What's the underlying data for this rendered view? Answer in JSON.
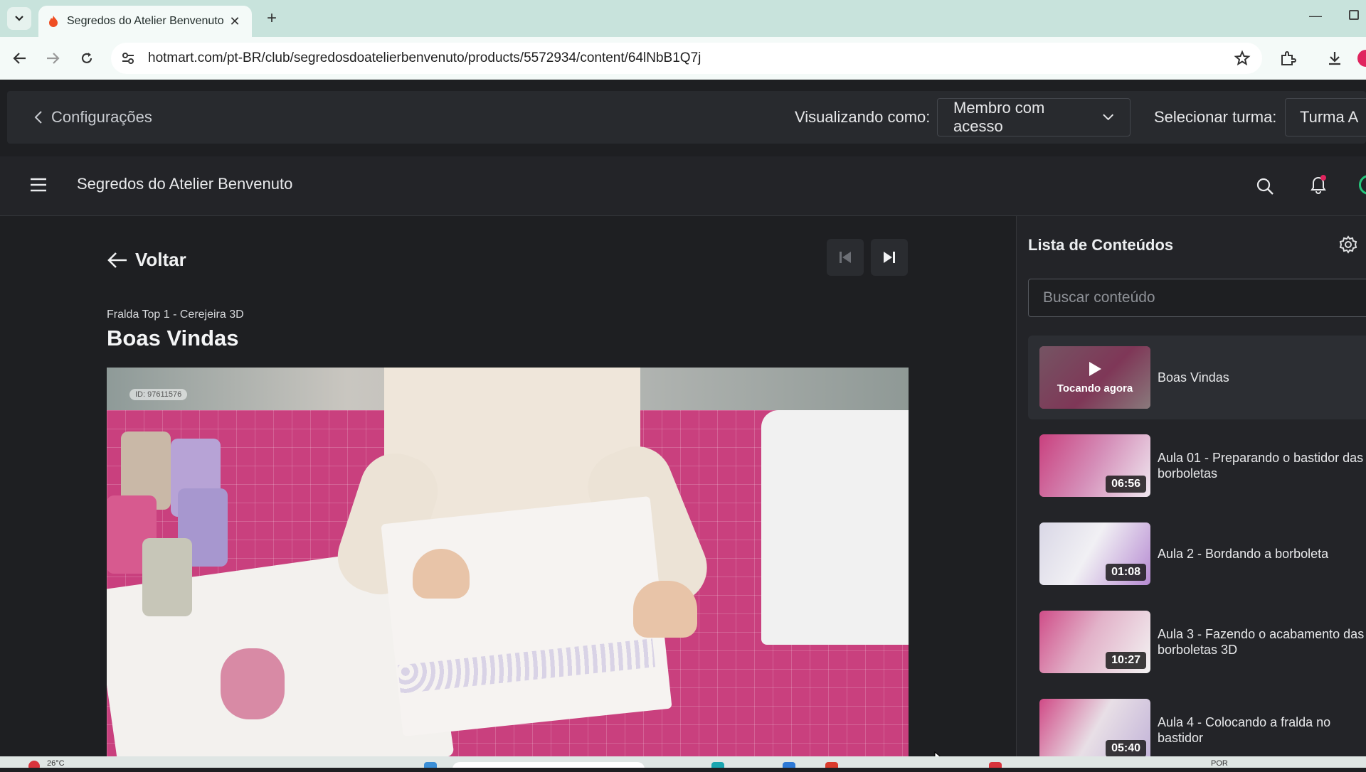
{
  "browser": {
    "tab_title": "Segredos do Atelier Benvenuto",
    "url": "hotmart.com/pt-BR/club/segredosdoatelierbenvenuto/products/5572934/content/64lNbB1Q7j"
  },
  "admin_bar": {
    "config_label": "Configurações",
    "viewing_label": "Visualizando como:",
    "viewing_value": "Membro com acesso",
    "class_label": "Selecionar turma:",
    "class_value": "Turma A"
  },
  "header": {
    "club_title": "Segredos do Atelier Benvenuto"
  },
  "main": {
    "back_label": "Voltar",
    "module_name": "Fralda Top 1 - Cerejeira 3D",
    "lesson_title": "Boas Vindas",
    "video_id": "ID: 97611576"
  },
  "sidebar": {
    "title": "Lista de Conteúdos",
    "search_placeholder": "Buscar conteúdo",
    "now_playing": "Tocando agora",
    "lessons": [
      {
        "title": "Boas Vindas",
        "duration": "",
        "active": true
      },
      {
        "title": "Aula 01 - Preparando o bastidor das borboletas",
        "duration": "06:56"
      },
      {
        "title": "Aula 2 - Bordando a borboleta",
        "duration": "01:08"
      },
      {
        "title": "Aula 3 - Fazendo o acabamento das borboletas 3D",
        "duration": "10:27"
      },
      {
        "title": "Aula 4 - Colocando a fralda no bastidor",
        "duration": "05:40"
      }
    ]
  },
  "taskbar": {
    "temperature": "26°C",
    "language": "POR"
  },
  "colors": {
    "accent_green": "#24c67b",
    "notification_red": "#e0245e",
    "mat_pink": "#c9407e"
  }
}
